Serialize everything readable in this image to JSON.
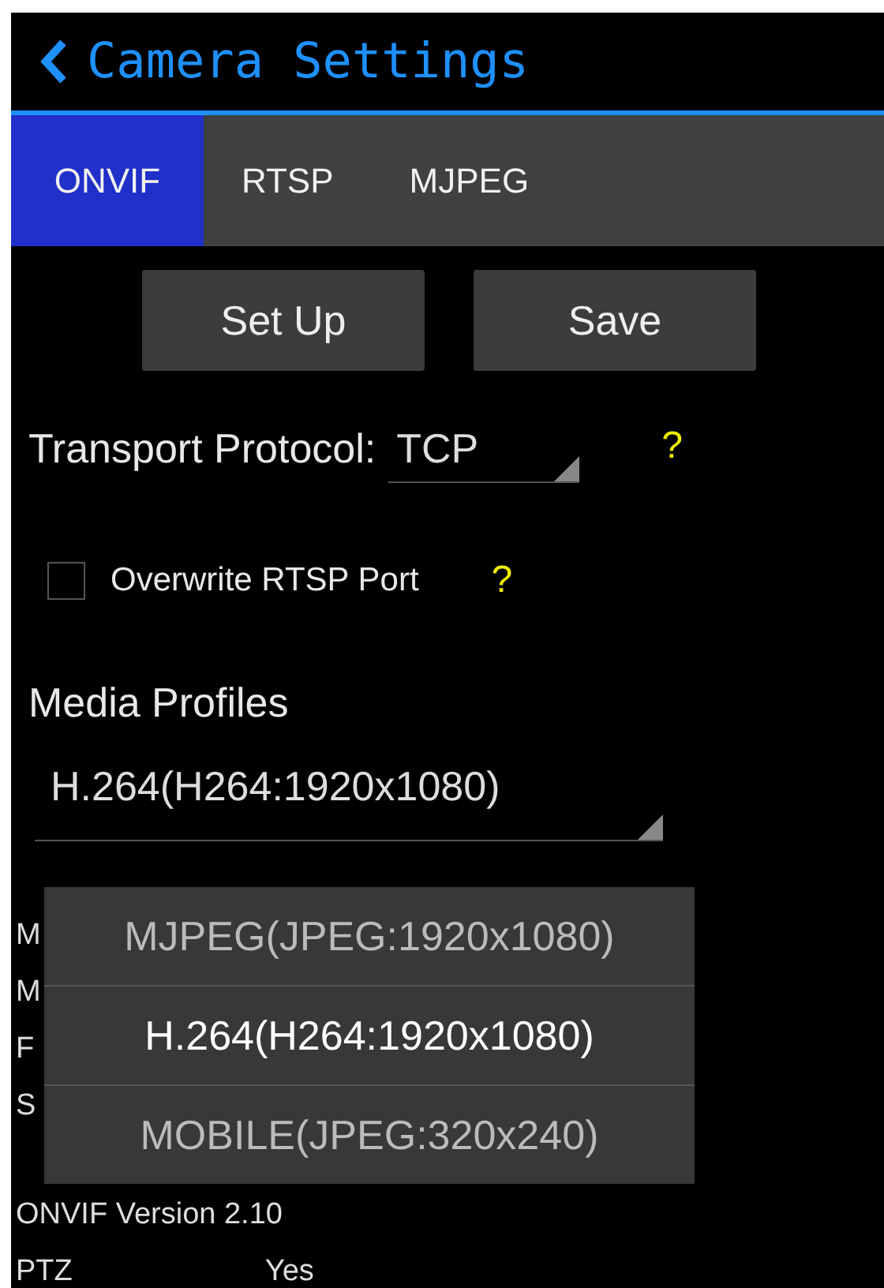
{
  "title": "Camera Settings",
  "tabs": [
    {
      "label": "ONVIF",
      "selected": true
    },
    {
      "label": "RTSP",
      "selected": false
    },
    {
      "label": "MJPEG",
      "selected": false
    }
  ],
  "buttons": [
    "Set Up",
    "Save"
  ],
  "transport": {
    "label": "Transport Protocol:",
    "value": "TCP",
    "help": "?"
  },
  "overwrite": {
    "label": "Overwrite RTSP Port",
    "checked": false,
    "help": "?"
  },
  "media_profiles": {
    "label": "Media Profiles",
    "value": "H.264(H264:1920x1080)"
  },
  "info_lines": [
    {
      "label": "M"
    },
    {
      "label": "M"
    },
    {
      "label": "F"
    },
    {
      "label": "S"
    },
    {
      "label": "ONVIF Version 2.10"
    },
    {
      "label": "PTZ",
      "value": "Yes"
    }
  ],
  "profile_menu": [
    {
      "label": "MJPEG(JPEG:1920x1080)",
      "selected": false
    },
    {
      "label": "H.264(H264:1920x1080)",
      "selected": true
    },
    {
      "label": "MOBILE(JPEG:320x240)",
      "selected": false
    }
  ]
}
